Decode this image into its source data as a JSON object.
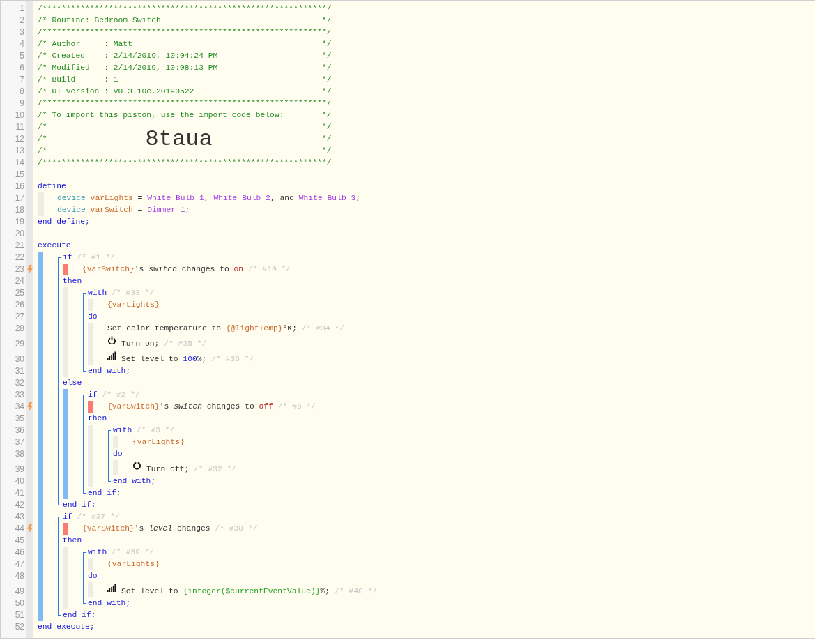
{
  "line_numbers": [
    "1",
    "2",
    "3",
    "4",
    "5",
    "6",
    "7",
    "8",
    "9",
    "10",
    "11",
    "12",
    "13",
    "14",
    "15",
    "16",
    "17",
    "18",
    "19",
    "20",
    "21",
    "22",
    "23",
    "24",
    "25",
    "26",
    "27",
    "28",
    "29",
    "30",
    "31",
    "32",
    "33",
    "34",
    "35",
    "36",
    "37",
    "38",
    "39",
    "40",
    "41",
    "42",
    "43",
    "44",
    "45",
    "46",
    "47",
    "48",
    "49",
    "50",
    "51",
    "52"
  ],
  "header": [
    {
      "text": "/************************************************************/"
    },
    {
      "text": "/* Routine: Bedroom Switch",
      "end": "*/"
    },
    {
      "text": "/************************************************************/"
    },
    {
      "text": "/* Author     : Matt",
      "end": "*/"
    },
    {
      "text": "/* Created    : 2/14/2019, 10:04:24 PM",
      "end": "*/"
    },
    {
      "text": "/* Modified   : 2/14/2019, 10:08:13 PM",
      "end": "*/"
    },
    {
      "text": "/* Build      : 1",
      "end": "*/"
    },
    {
      "text": "/* UI version : v0.3.10c.20190522",
      "end": "*/"
    },
    {
      "text": "/************************************************************/"
    },
    {
      "text": "/* To import this piston, use the import code below:",
      "end": "*/"
    },
    {
      "text": "/*",
      "end": "*/"
    },
    {
      "text": "/*",
      "import_code": "8taua",
      "end": "*/"
    },
    {
      "text": "/*",
      "end": "*/"
    },
    {
      "text": "/************************************************************/"
    }
  ],
  "define": {
    "keyword": "define",
    "declarations": [
      [
        {
          "kind": "type",
          "text": "device"
        },
        {
          "kind": "variable",
          "text": " varLights"
        },
        {
          "kind": "plain",
          "text": " = "
        },
        {
          "kind": "device",
          "text": "White Bulb 1"
        },
        {
          "kind": "plain",
          "text": ", "
        },
        {
          "kind": "device",
          "text": "White Bulb 2"
        },
        {
          "kind": "plain",
          "text": ", and "
        },
        {
          "kind": "device",
          "text": "White Bulb 3"
        },
        {
          "kind": "plain",
          "text": ";"
        }
      ],
      [
        {
          "kind": "type",
          "text": "device"
        },
        {
          "kind": "variable",
          "text": " varSwitch"
        },
        {
          "kind": "plain",
          "text": " = "
        },
        {
          "kind": "device",
          "text": "Dimmer 1"
        },
        {
          "kind": "plain",
          "text": ";"
        }
      ]
    ],
    "end": "end define;"
  },
  "execute": {
    "keyword": "execute",
    "end": "end execute;",
    "statements": [
      {
        "keyword": "if",
        "comment": "/* #1 */",
        "conditions": [
          {
            "trigger": true,
            "tokens": [
              {
                "kind": "variable",
                "text": "{varSwitch}"
              },
              {
                "kind": "plain",
                "text": "'s "
              },
              {
                "kind": "attribute",
                "text": "switch"
              },
              {
                "kind": "plain",
                "text": " changes to "
              },
              {
                "kind": "value",
                "text": "on"
              },
              {
                "kind": "dim",
                "text": " /* #10 */"
              }
            ]
          }
        ],
        "then_keyword": "then",
        "then": [
          {
            "keyword": "with",
            "comment": "/* #33 */",
            "devices": [
              [
                {
                  "kind": "variable",
                  "text": "{varLights}"
                }
              ]
            ],
            "do_keyword": "do",
            "actions": [
              {
                "tokens": [
                  {
                    "kind": "plain",
                    "text": "Set color temperature to "
                  },
                  {
                    "kind": "variable",
                    "text": "{@lightTemp}"
                  },
                  {
                    "kind": "plain",
                    "text": "°K; "
                  },
                  {
                    "kind": "dim",
                    "text": "/* #34 */"
                  }
                ]
              },
              {
                "kind": "power",
                "tokens": [
                  {
                    "kind": "plain",
                    "text": "Turn on; "
                  },
                  {
                    "kind": "dim",
                    "text": "/* #35 */"
                  }
                ]
              },
              {
                "kind": "level",
                "tokens": [
                  {
                    "kind": "plain",
                    "text": "Set level to "
                  },
                  {
                    "kind": "number",
                    "text": "100"
                  },
                  {
                    "kind": "plain",
                    "text": "%; "
                  },
                  {
                    "kind": "dim",
                    "text": "/* #36 */"
                  }
                ]
              }
            ],
            "end": "end with;"
          }
        ],
        "else_keyword": "else",
        "else": [
          {
            "keyword": "if",
            "comment": "/* #2 */",
            "conditions": [
              {
                "trigger": true,
                "tokens": [
                  {
                    "kind": "variable",
                    "text": "{varSwitch}"
                  },
                  {
                    "kind": "plain",
                    "text": "'s "
                  },
                  {
                    "kind": "attribute",
                    "text": "switch"
                  },
                  {
                    "kind": "plain",
                    "text": " changes to "
                  },
                  {
                    "kind": "value",
                    "text": "off"
                  },
                  {
                    "kind": "dim",
                    "text": " /* #6 */"
                  }
                ]
              }
            ],
            "then_keyword": "then",
            "then": [
              {
                "keyword": "with",
                "comment": "/* #3 */",
                "devices": [
                  [
                    {
                      "kind": "variable",
                      "text": "{varLights}"
                    }
                  ]
                ],
                "do_keyword": "do",
                "actions": [
                  {
                    "kind": "off",
                    "tokens": [
                      {
                        "kind": "plain",
                        "text": "Turn off; "
                      },
                      {
                        "kind": "dim",
                        "text": "/* #32 */"
                      }
                    ]
                  }
                ],
                "end": "end with;"
              }
            ],
            "end": "end if;"
          }
        ],
        "end": "end if;"
      },
      {
        "keyword": "if",
        "comment": "/* #37 */",
        "conditions": [
          {
            "trigger": true,
            "tokens": [
              {
                "kind": "variable",
                "text": "{varSwitch}"
              },
              {
                "kind": "plain",
                "text": "'s "
              },
              {
                "kind": "attribute",
                "text": "level"
              },
              {
                "kind": "plain",
                "text": " changes "
              },
              {
                "kind": "dim",
                "text": "/* #38 */"
              }
            ]
          }
        ],
        "then_keyword": "then",
        "then": [
          {
            "keyword": "with",
            "comment": "/* #39 */",
            "devices": [
              [
                {
                  "kind": "variable",
                  "text": "{varLights}"
                }
              ]
            ],
            "do_keyword": "do",
            "actions": [
              {
                "kind": "level",
                "tokens": [
                  {
                    "kind": "plain",
                    "text": "Set level to "
                  },
                  {
                    "kind": "expression",
                    "text": "{integer($currentEventValue)}"
                  },
                  {
                    "kind": "plain",
                    "text": "%; "
                  },
                  {
                    "kind": "dim",
                    "text": "/* #40 */"
                  }
                ]
              }
            ],
            "end": "end with;"
          }
        ],
        "end": "end if;"
      }
    ]
  }
}
